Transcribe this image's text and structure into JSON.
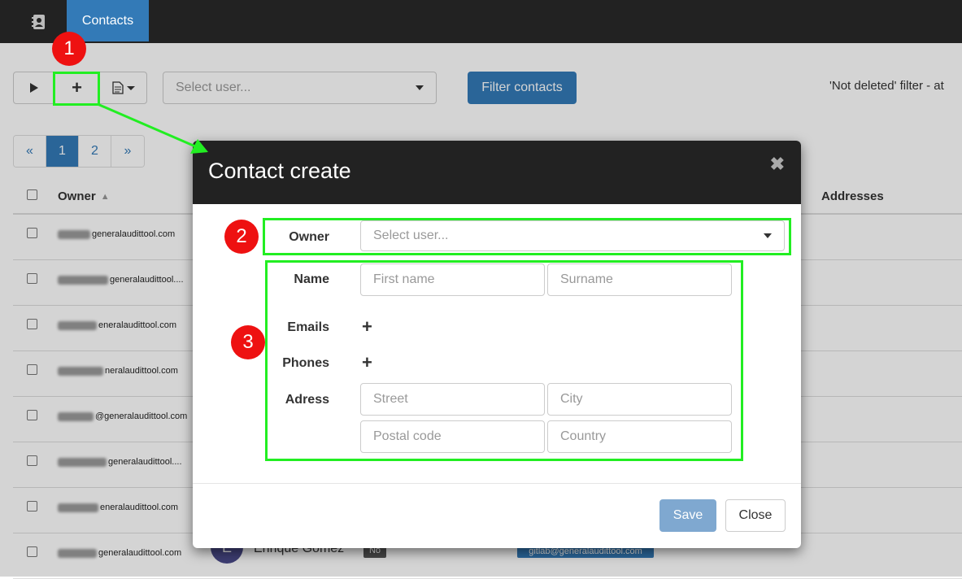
{
  "navbar": {
    "icon": "address-book-icon",
    "tab_label": "Contacts"
  },
  "toolbar": {
    "play_icon": "play-icon",
    "add_label": "+",
    "export_icon": "document-icon",
    "user_select_placeholder": "Select user...",
    "filter_label": "Filter contacts",
    "filter_status": "'Not deleted' filter -  at"
  },
  "pagination": {
    "prev": "«",
    "pages": [
      "1",
      "2"
    ],
    "next": "»",
    "active": "1"
  },
  "table": {
    "headers": {
      "owner": "Owner",
      "addresses": "Addresses"
    },
    "rows": [
      {
        "owner": "generalaudittool.com"
      },
      {
        "owner": "generalaudittool...."
      },
      {
        "owner": "eneralaudittool.com"
      },
      {
        "owner": "neralaudittool.com"
      },
      {
        "owner": "@generalaudittool.com"
      },
      {
        "owner": "generalaudittool...."
      },
      {
        "owner": "eneralaudittool.com"
      },
      {
        "owner": "generalaudittool.com"
      }
    ],
    "last_row": {
      "avatar_initial": "E",
      "name": "Enrique Gomez",
      "badge": "No",
      "email": "gitlab@generalaudittool.com"
    }
  },
  "modal": {
    "title": "Contact create",
    "close_icon": "close-icon",
    "labels": {
      "owner": "Owner",
      "name": "Name",
      "emails": "Emails",
      "phones": "Phones",
      "address": "Adress"
    },
    "placeholders": {
      "owner": "Select user...",
      "first_name": "First name",
      "surname": "Surname",
      "street": "Street",
      "city": "City",
      "postal_code": "Postal code",
      "country": "Country"
    },
    "add_email": "+",
    "add_phone": "+",
    "save_label": "Save",
    "close_label": "Close"
  },
  "annotations": {
    "step1": "1",
    "step2": "2",
    "step3": "3",
    "highlight_color": "#22ee22",
    "marker_color": "#ee1111"
  }
}
